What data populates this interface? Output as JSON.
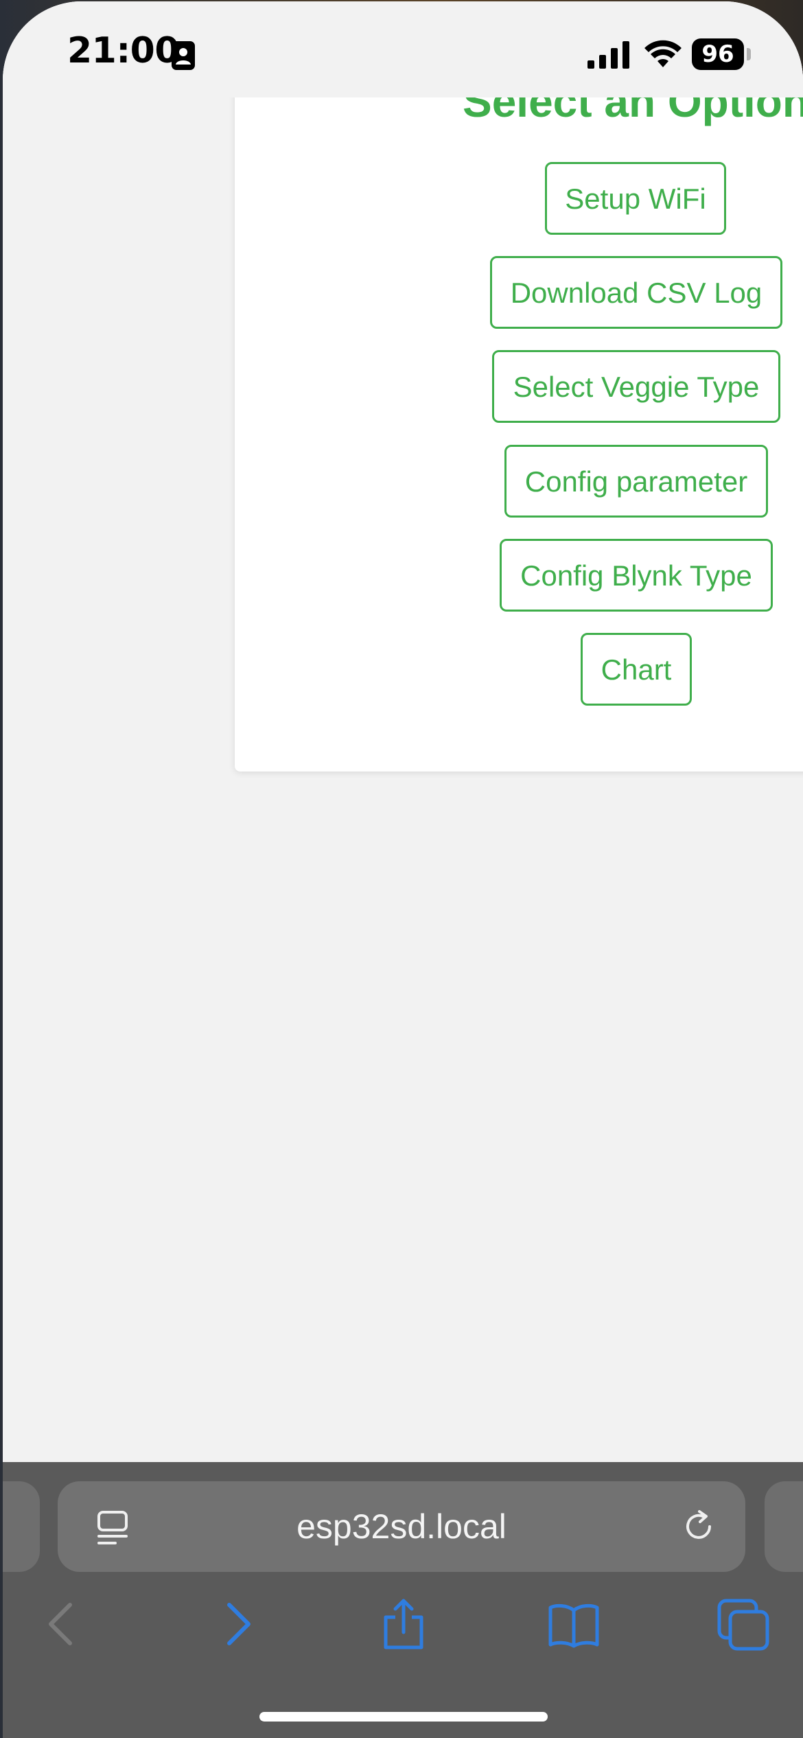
{
  "status_bar": {
    "time": "21:00",
    "battery": "96",
    "icons": [
      "contact-card-icon",
      "cellular-signal-icon",
      "wifi-icon",
      "battery-icon"
    ]
  },
  "page": {
    "title": "Select an Option",
    "buttons": [
      "Setup WiFi",
      "Download CSV Log",
      "Select Veggie Type",
      "Config parameter",
      "Config Blynk Type",
      "Chart"
    ]
  },
  "browser": {
    "url": "esp32sd.local",
    "toolbar": [
      "back-icon",
      "forward-icon",
      "share-icon",
      "bookmarks-icon",
      "tabs-icon"
    ]
  },
  "colors": {
    "accent": "#3fae4b",
    "toolbar_blue": "#2f7de0",
    "toolbar_bg": "#5a5a5a",
    "page_bg": "#f2f2f2"
  }
}
